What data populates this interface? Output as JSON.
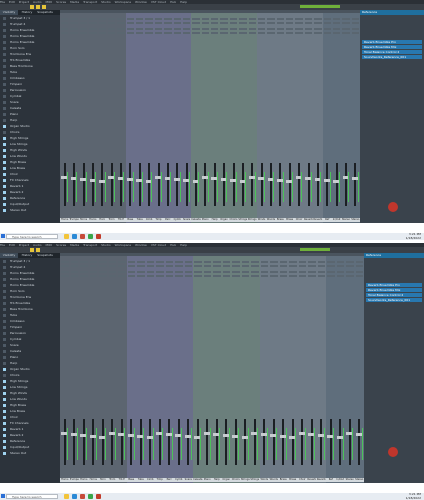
{
  "app": {
    "menu_items": [
      "File",
      "Edit",
      "Project",
      "Audio",
      "MIDI",
      "Scores",
      "Media",
      "Transport",
      "Studio",
      "Workspace",
      "Window",
      "VST Cloud",
      "Hub",
      "Help"
    ],
    "tabs": [
      "Visibility",
      "History",
      "Snapshots"
    ],
    "window_title": "Mixer Console 1"
  },
  "tracks": [
    "Trumpet 3 / 1",
    "Trumpet 4",
    "Horns Ensemble",
    "Horns Ensemble",
    "Horns Ensemble",
    "Horn Solo",
    "Trombone Ens",
    "Trb Ensemble",
    "Bass Trombone",
    "Tuba",
    "Cimbasso",
    "Timpani",
    "Percussion",
    "Cymbal",
    "Snare",
    "Celesta",
    "Piano",
    "Harp",
    "Organ Studio",
    "Choirs",
    "High Strings",
    "Low Strings",
    "High Winds",
    "Low Woods",
    "High Brass",
    "Low Brass",
    "Choir",
    "FX Channels",
    "Reverb 1",
    "Reverb 2",
    "Reference",
    "Input/Output",
    "Stereo Out"
  ],
  "checked_tracks": [
    "Organ Studio",
    "High Strings",
    "Low Strings",
    "High Winds",
    "Low Woods",
    "High Brass",
    "Low Brass",
    "Choir",
    "FX Channels",
    "Reverb 1",
    "Reverb 2",
    "Reference",
    "Input/Output",
    "Stereo Out"
  ],
  "strip_names": [
    "Horns",
    "Trumpet",
    "Horns E",
    "Horns Sol",
    "Horn",
    "Trom",
    "Trb E",
    "Bass",
    "Tuba",
    "Cimb",
    "Timp",
    "Perc",
    "Cymb",
    "Snare",
    "Celesta",
    "Piano",
    "Harp",
    "Organ",
    "Choirs",
    "Strings",
    "Strings",
    "Winds",
    "Woods",
    "Brass",
    "Brass",
    "Choir",
    "Reverb",
    "Reverb",
    "Ref",
    "In/Out",
    "Stereo",
    "Stereo"
  ],
  "right_panel": {
    "header": "Reference",
    "items": [
      "Reverb Ensemble Pro",
      "Reverb Ensemble Mix",
      "Tonal Balance Control 2",
      "Soundworks_Reference_001"
    ]
  },
  "taskbar": {
    "search_placeholder": "Type here to search",
    "time": "3:21 PM",
    "date": "1/18/2022"
  },
  "colors": {
    "accent_blue": "#2878b0",
    "meter_green": "#4cc25a",
    "toolbar_yellow": "#e6c53a",
    "record_red": "#c0362c"
  }
}
